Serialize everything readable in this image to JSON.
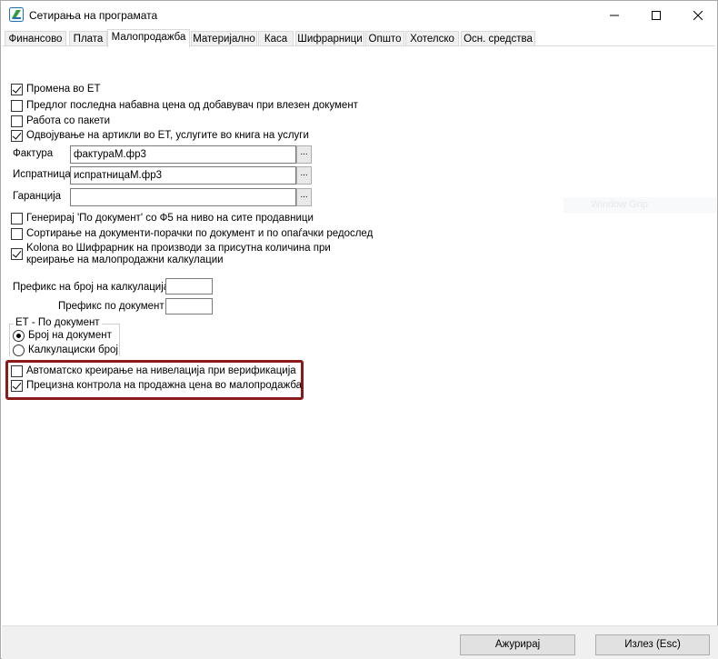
{
  "window": {
    "title": "Сетирања на програмата",
    "icons": {
      "app": "app-logo-icon",
      "minimize": "minimize-icon",
      "maximize": "maximize-icon",
      "close": "close-icon"
    }
  },
  "tabs": [
    {
      "label": "Финансово",
      "active": false
    },
    {
      "label": "Плата",
      "active": false
    },
    {
      "label": "Малопродажба",
      "active": true
    },
    {
      "label": "Материјално",
      "active": false
    },
    {
      "label": "Каса",
      "active": false
    },
    {
      "label": "Шифрарници",
      "active": false
    },
    {
      "label": "Општо",
      "active": false
    },
    {
      "label": "Хотелско",
      "active": false
    },
    {
      "label": "Осн. средства",
      "active": false
    }
  ],
  "options": {
    "promena_et": {
      "label": "Промена во ЕТ",
      "checked": true
    },
    "predlog_cena": {
      "label": "Предлог последна набавна цена од добавувач при влезен документ",
      "checked": false
    },
    "rabota_paketi": {
      "label": "Работа со пакети",
      "checked": false
    },
    "odvojuvanje": {
      "label": "Одвојување на артикли во ЕТ, услугите во книга на услуги",
      "checked": true
    },
    "generiraj": {
      "label": "Генерирај 'По документ' со Ф5 на ниво на сите продавници",
      "checked": false
    },
    "sortiranje": {
      "label": "Сортирање на документи-порачки по документ и по опаѓачки редослед",
      "checked": false
    },
    "kolona": {
      "label": "Kolona во Шифрарник на производи за присутна количина при креирање на малопродажни калкулации",
      "checked": true
    },
    "avtomatsko": {
      "label": "Автоматско креирање на нивелација при верификација",
      "checked": false
    },
    "precizna": {
      "label": "Прецизна контрола на продажна цена во малопродажба",
      "checked": true
    }
  },
  "fields": {
    "faktura": {
      "label": "Фактура",
      "value": "фактураМ.фр3"
    },
    "ispratnica": {
      "label": "Испратница",
      "value": "испратницаМ.фр3"
    },
    "garancija": {
      "label": "Гаранција",
      "value": ""
    },
    "browse_label": "...",
    "prefiks_kalkulacija": {
      "label": "Префикс на број на калкулација",
      "value": ""
    },
    "prefiks_dokument": {
      "label": "Префикс по документ",
      "value": ""
    }
  },
  "et_group": {
    "title": "ЕТ - По документ",
    "options": [
      {
        "label": "Број на документ",
        "selected": true
      },
      {
        "label": "Калкулациски број",
        "selected": false
      }
    ]
  },
  "buttons": {
    "update": "Ажурирај",
    "exit": "Излез (Esc)"
  },
  "ghost_text": "Window Grip",
  "colors": {
    "highlight": "#8b1a1a",
    "logo_green": "#2e9e3e",
    "logo_blue": "#1e6fb8"
  }
}
